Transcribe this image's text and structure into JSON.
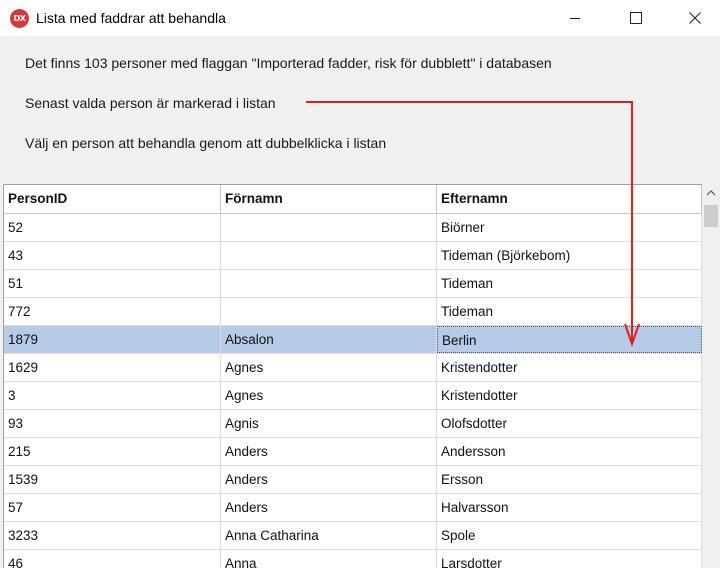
{
  "window": {
    "title": "Lista med faddrar att behandla",
    "app_icon_text": "DX",
    "app_icon_color": "#d9383a",
    "controls": {
      "minimize_icon": "minimize-icon",
      "maximize_icon": "maximize-icon",
      "close_icon": "close-icon"
    }
  },
  "info": {
    "line1": "Det finns 103 personer med flaggan \"Importerad fadder, risk för dubblett\" i databasen",
    "line2": "Senast valda person är markerad i listan",
    "line3": "Välj en person att behandla genom att dubbelklicka i listan"
  },
  "annotation": {
    "arrow_color": "#e02020"
  },
  "table": {
    "columns": [
      "PersonID",
      "Förnamn",
      "Efternamn"
    ],
    "selected_color": "#b5cbe8",
    "rows": [
      {
        "id": "52",
        "first": "",
        "last": "Biörner",
        "selected": false
      },
      {
        "id": "43",
        "first": "",
        "last": "Tideman (Björkebom)",
        "selected": false
      },
      {
        "id": "51",
        "first": "",
        "last": "Tideman",
        "selected": false
      },
      {
        "id": "772",
        "first": "",
        "last": "Tideman",
        "selected": false
      },
      {
        "id": "1879",
        "first": "Absalon",
        "last": "Berlin",
        "selected": true
      },
      {
        "id": "1629",
        "first": "Agnes",
        "last": "Kristendotter",
        "selected": false
      },
      {
        "id": "3",
        "first": "Agnes",
        "last": "Kristendotter",
        "selected": false
      },
      {
        "id": "93",
        "first": "Agnis",
        "last": "Olofsdotter",
        "selected": false
      },
      {
        "id": "215",
        "first": "Anders",
        "last": "Andersson",
        "selected": false
      },
      {
        "id": "1539",
        "first": "Anders",
        "last": "Ersson",
        "selected": false
      },
      {
        "id": "57",
        "first": "Anders",
        "last": "Halvarsson",
        "selected": false
      },
      {
        "id": "3233",
        "first": "Anna Catharina",
        "last": "Spole",
        "selected": false
      },
      {
        "id": "46",
        "first": "Anna",
        "last": "Larsdotter",
        "selected": false
      }
    ]
  }
}
